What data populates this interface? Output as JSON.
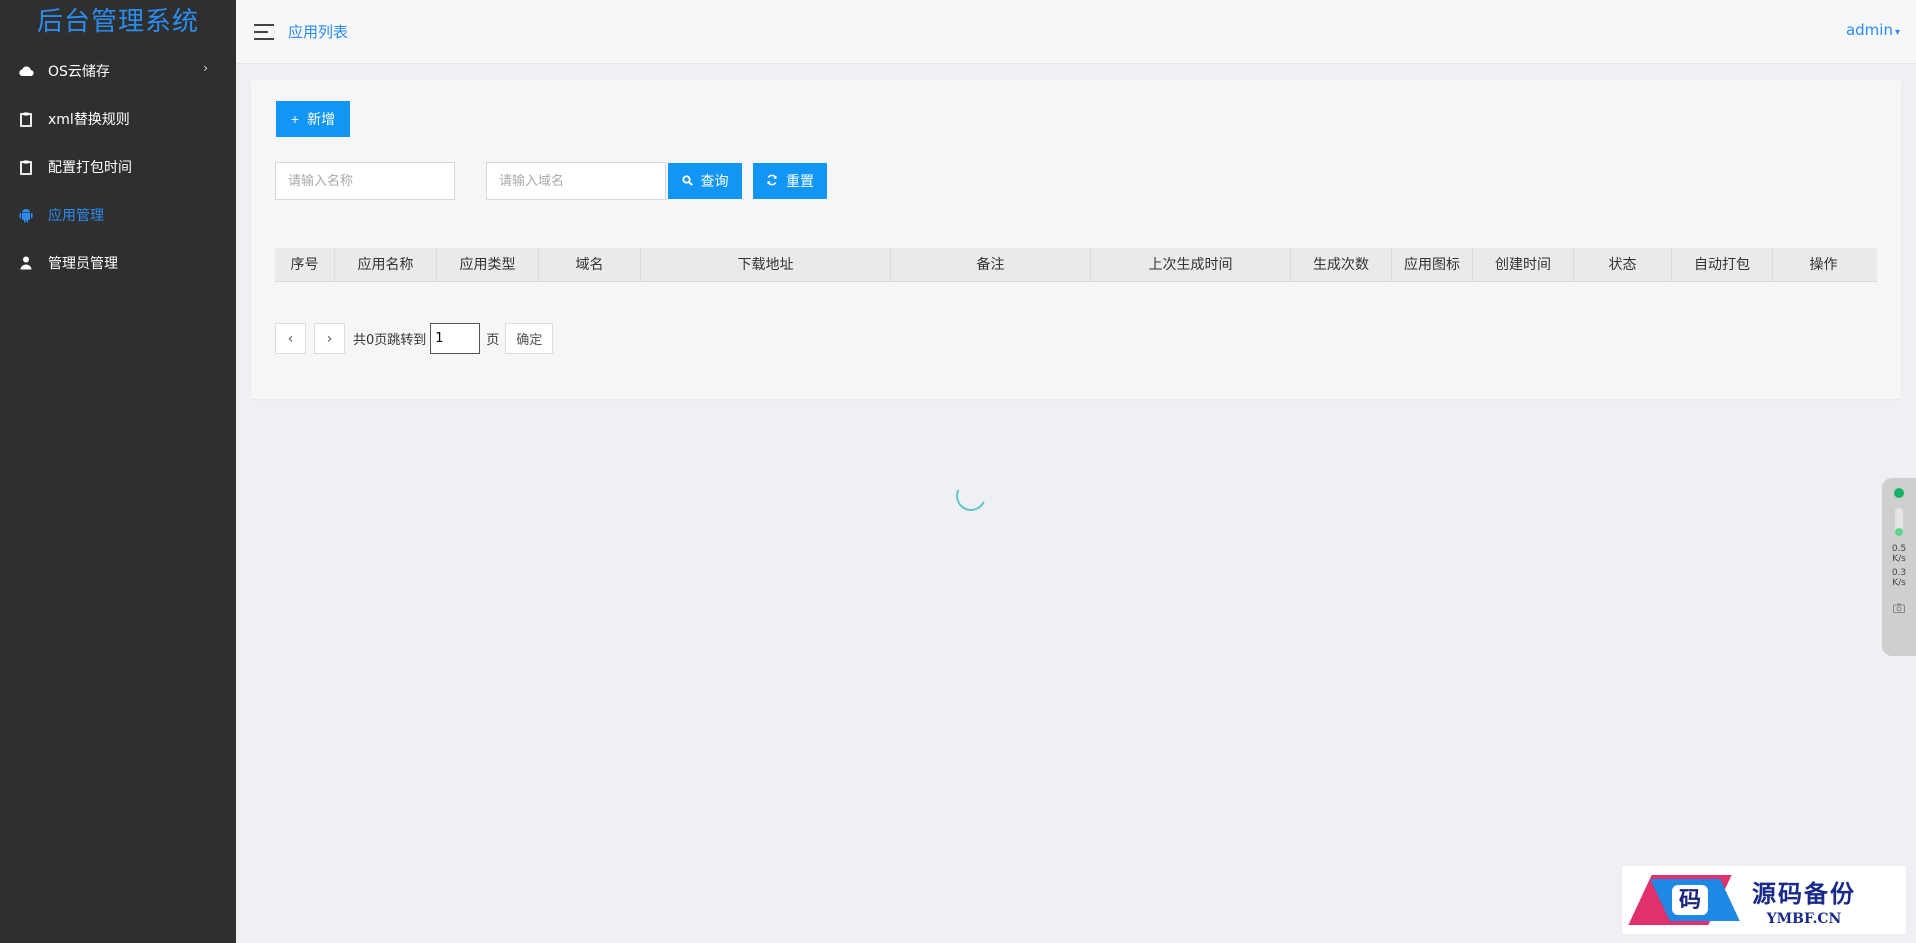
{
  "brand": "后台管理系统",
  "sidebar": {
    "items": [
      {
        "label": "OS云储存",
        "icon": "cloud-icon",
        "arrow": "›"
      },
      {
        "label": "xml替换规则",
        "icon": "clipboard-icon"
      },
      {
        "label": "配置打包时间",
        "icon": "clipboard-icon"
      },
      {
        "label": "应用管理",
        "icon": "android-icon",
        "active": true
      },
      {
        "label": "管理员管理",
        "icon": "user-icon"
      }
    ]
  },
  "header": {
    "title": "应用列表",
    "user": "admin",
    "user_caret": "▾"
  },
  "toolbar": {
    "add_icon": "+",
    "add_label": "新增",
    "name_placeholder": "请输入名称",
    "domain_placeholder": "请输入域名",
    "search_label": "查询",
    "reset_label": "重置"
  },
  "table": {
    "columns": [
      "序号",
      "应用名称",
      "应用类型",
      "域名",
      "下载地址",
      "备注",
      "上次生成时间",
      "生成次数",
      "应用图标",
      "创建时间",
      "状态",
      "自动打包",
      "操作"
    ],
    "rows": []
  },
  "pagination": {
    "prev": "‹",
    "next": "›",
    "total_text": "共0页跳转到",
    "page_value": "1",
    "page_unit": "页",
    "confirm": "确定"
  },
  "widget": {
    "up_speed": "0.5",
    "up_unit": "K/s",
    "down_speed": "0.3",
    "down_unit": "K/s"
  },
  "watermark": {
    "glyph": "码",
    "cn": "源码备份",
    "en": "YMBF.CN"
  },
  "colors": {
    "accent": "#1296f5",
    "sidebar_bg": "#2f2f2f",
    "link": "#2b8cf0"
  }
}
